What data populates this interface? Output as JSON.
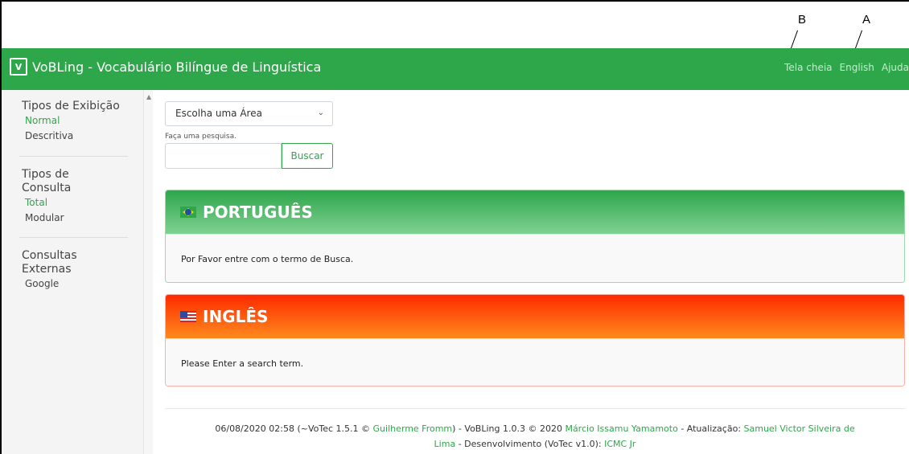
{
  "annotations": {
    "b": "B",
    "a": "A"
  },
  "app": {
    "logo_text": "V",
    "title": "VoBLing - Vocabulário Bilíngue de Linguística",
    "nav": [
      "Tela cheia",
      "English",
      "Ajuda"
    ]
  },
  "sidebar": {
    "sections": [
      {
        "title": "Tipos de Exibição",
        "items": [
          "Normal",
          "Descritiva"
        ]
      },
      {
        "title": "Tipos de Consulta",
        "title_lines": [
          "Tipos de",
          "Consulta"
        ],
        "items": [
          "Total",
          "Modular"
        ]
      },
      {
        "title": "Consultas Externas",
        "title_lines": [
          "Consultas",
          "Externas"
        ],
        "items": [
          "Google"
        ]
      }
    ]
  },
  "search": {
    "select_value": "Escolha uma Área",
    "hint": "Faça uma pesquisa.",
    "input_value": "",
    "button_label": "Buscar"
  },
  "panels": {
    "pt": {
      "title": "PORTUGUÊS",
      "body": "Por Favor entre com o termo de Busca."
    },
    "en": {
      "title": "INGLÊS",
      "body": "Please Enter a search term."
    }
  },
  "footer": {
    "p1": "06/08/2020 02:58 (~VoTec 1.5.1 © ",
    "l1": "Guilherme Fromm",
    "p2": ") - VoBLing 1.0.3 © 2020 ",
    "l2": "Márcio Issamu Yamamoto",
    "p3": " - Atualização: ",
    "l3a": "Samuel Victor Silveira de",
    "l3b": "Lima",
    "p4": " - Desenvolvimento (VoTec v1.0): ",
    "l4": "ICMC Jr"
  },
  "colors": {
    "green": "#2ea64a",
    "red": "#ff2a00",
    "orange": "#ff8a1c"
  }
}
